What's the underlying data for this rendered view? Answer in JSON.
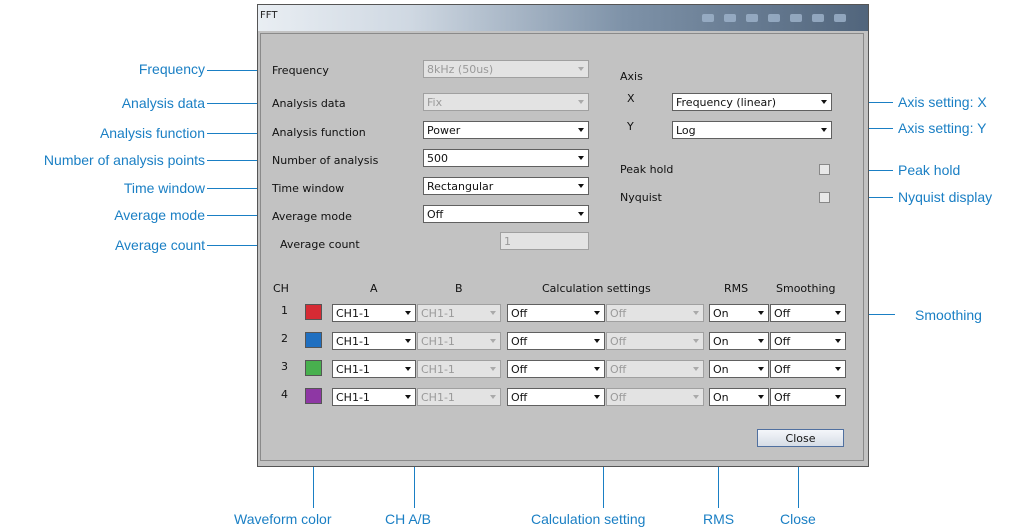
{
  "window": {
    "title": "FFT"
  },
  "settings": {
    "frequency": {
      "label": "Frequency",
      "value": "8kHz (50us)"
    },
    "analysis_data": {
      "label": "Analysis data",
      "value": "Fix"
    },
    "analysis_function": {
      "label": "Analysis function",
      "value": "Power"
    },
    "analysis_points": {
      "label": "Number of analysis",
      "value": "500"
    },
    "time_window": {
      "label": "Time window",
      "value": "Rectangular"
    },
    "average_mode": {
      "label": "Average mode",
      "value": "Off"
    },
    "average_count": {
      "label": "Average count",
      "value": "1"
    }
  },
  "axis": {
    "title": "Axis",
    "x_label": "X",
    "x_value": "Frequency (linear)",
    "y_label": "Y",
    "y_value": "Log",
    "peak_hold": "Peak hold",
    "nyquist": "Nyquist"
  },
  "table": {
    "headers": {
      "ch": "CH",
      "a": "A",
      "b": "B",
      "calc": "Calculation settings",
      "rms": "RMS",
      "smoothing": "Smoothing"
    },
    "rows": [
      {
        "ch": "1",
        "color": "#d62b34",
        "a": "CH1-1",
        "b": "CH1-1",
        "calc1": "Off",
        "calc2": "Off",
        "rms": "On",
        "smoothing": "Off"
      },
      {
        "ch": "2",
        "color": "#1f6fc0",
        "a": "CH1-1",
        "b": "CH1-1",
        "calc1": "Off",
        "calc2": "Off",
        "rms": "On",
        "smoothing": "Off"
      },
      {
        "ch": "3",
        "color": "#48b04e",
        "a": "CH1-1",
        "b": "CH1-1",
        "calc1": "Off",
        "calc2": "Off",
        "rms": "On",
        "smoothing": "Off"
      },
      {
        "ch": "4",
        "color": "#8e37a4",
        "a": "CH1-1",
        "b": "CH1-1",
        "calc1": "Off",
        "calc2": "Off",
        "rms": "On",
        "smoothing": "Off"
      }
    ]
  },
  "close_label": "Close",
  "annotations": {
    "frequency": "Frequency",
    "analysis_data": "Analysis data",
    "analysis_function": "Analysis function",
    "analysis_points": "Number of analysis points",
    "time_window": "Time window",
    "average_mode": "Average mode",
    "average_count": "Average count",
    "axis_x": "Axis setting: X",
    "axis_y": "Axis setting: Y",
    "peak_hold": "Peak hold",
    "nyquist": "Nyquist display",
    "smoothing": "Smoothing",
    "waveform_color": "Waveform color",
    "ch_ab": "CH A/B",
    "calc_setting": "Calculation setting",
    "rms": "RMS",
    "close": "Close"
  }
}
